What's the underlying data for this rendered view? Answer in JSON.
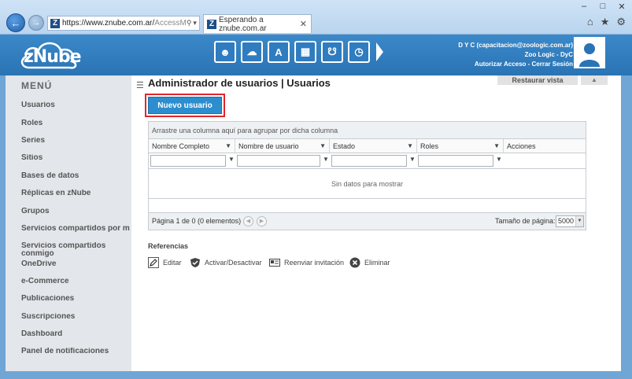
{
  "browser": {
    "address_url_main": "https://www.znube.com.ar/",
    "address_url_dim": "AccessM",
    "tab_title": "Esperando a znube.com.ar",
    "logo_letter": "Z"
  },
  "header": {
    "brand": "zNube",
    "modules": [
      "user-cloud-icon",
      "cloud-gear-icon",
      "ab-icon",
      "box-icon",
      "cart-icon",
      "clock-icon"
    ],
    "user_line1": "D Y C (capacitacion@zoologic.com.ar)",
    "user_line2": "Zoo Logic - DyC",
    "user_link_auth": "Autorizar Acceso",
    "user_link_sep": " - ",
    "user_link_logout": "Cerrar Sesión"
  },
  "sidebar": {
    "title": "MENÚ",
    "items": [
      {
        "label": "Usuarios"
      },
      {
        "label": "Roles"
      },
      {
        "label": "Series"
      },
      {
        "label": "Sitios"
      },
      {
        "label": "Bases de datos"
      },
      {
        "label": "Réplicas en zNube"
      },
      {
        "label": "Grupos"
      },
      {
        "label": "Servicios compartidos por mi"
      },
      {
        "label": "Servicios compartidos conmigo"
      },
      {
        "label": "OneDrive"
      },
      {
        "label": "e-Commerce"
      },
      {
        "label": "Publicaciones"
      },
      {
        "label": "Suscripciones"
      },
      {
        "label": "Dashboard"
      },
      {
        "label": "Panel de notificaciones"
      }
    ]
  },
  "main": {
    "title": "Administrador de usuarios | Usuarios",
    "restore_label": "Restaurar vista",
    "new_user_label": "Nuevo usuario",
    "grid": {
      "group_hint": "Arrastre una columna aquí para agrupar por dicha columna",
      "columns": [
        "Nombre Completo",
        "Nombre de usuario",
        "Estado",
        "Roles",
        "Acciones"
      ],
      "empty_text": "Sin datos para mostrar",
      "pager_text": "Página 1 de 0 (0 elementos)",
      "page_size_label": "Tamaño de página:",
      "page_size_value": "5000"
    },
    "references": {
      "title": "Referencias",
      "items": [
        {
          "label": "Editar",
          "icon": "pencil-icon"
        },
        {
          "label": "Activar/Desactivar",
          "icon": "check-shield-icon"
        },
        {
          "label": "Reenviar invitación",
          "icon": "mail-card-icon"
        },
        {
          "label": "Eliminar",
          "icon": "delete-circle-icon"
        }
      ]
    }
  }
}
